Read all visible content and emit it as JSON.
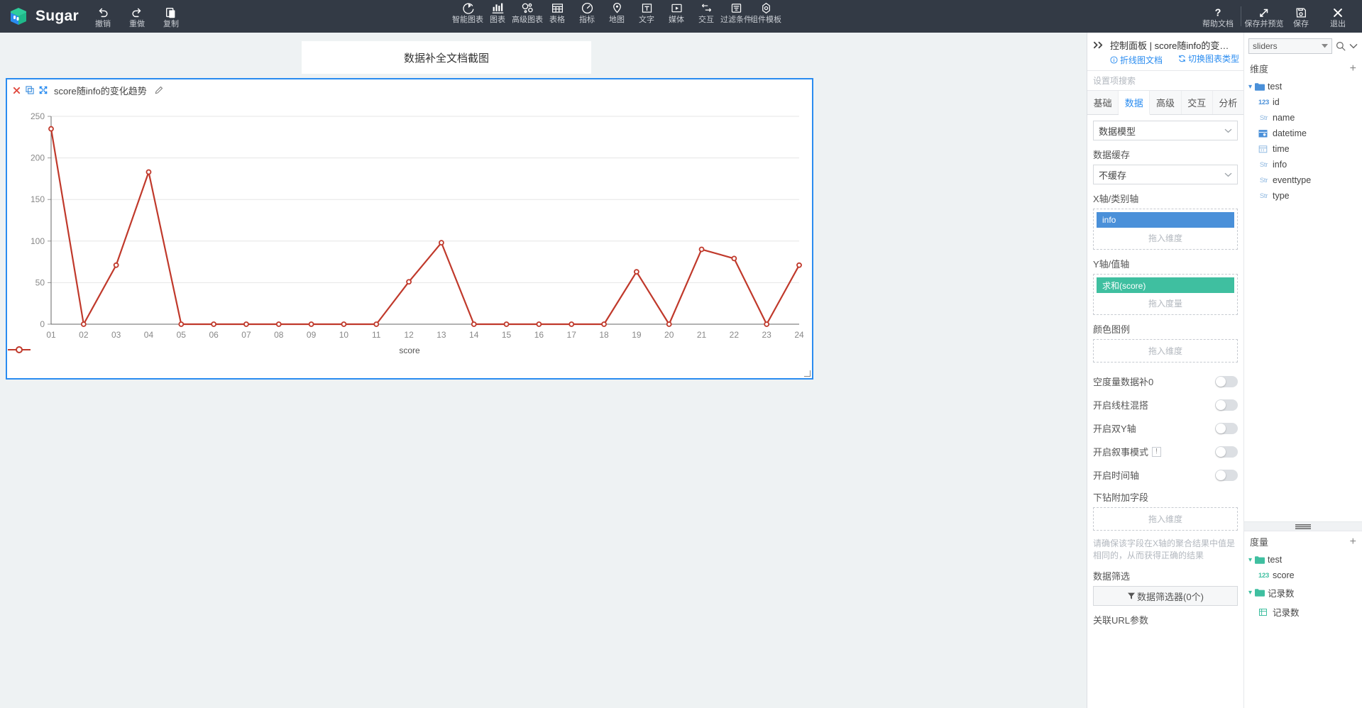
{
  "app": {
    "brand": "Sugar",
    "history": [
      {
        "icon": "undo-icon",
        "label": "撤销"
      },
      {
        "icon": "redo-icon",
        "label": "重做"
      },
      {
        "icon": "copy-icon",
        "label": "复制"
      }
    ],
    "insert_tools": [
      {
        "icon": "smart-chart-icon",
        "label": "智能图表"
      },
      {
        "icon": "chart-icon",
        "label": "图表"
      },
      {
        "icon": "advanced-chart-icon",
        "label": "高级图表"
      },
      {
        "icon": "table-icon",
        "label": "表格"
      },
      {
        "icon": "metric-icon",
        "label": "指标"
      },
      {
        "icon": "map-icon",
        "label": "地图"
      },
      {
        "icon": "text-icon",
        "label": "文字"
      },
      {
        "icon": "media-icon",
        "label": "媒体"
      },
      {
        "icon": "interaction-icon",
        "label": "交互"
      },
      {
        "icon": "filter-condition-icon",
        "label": "过滤条件"
      },
      {
        "icon": "component-template-icon",
        "label": "组件模板"
      }
    ],
    "right_tools": [
      {
        "icon": "help-icon",
        "label": "帮助文档"
      },
      {
        "icon": "save-preview-icon",
        "label": "保存并预览"
      },
      {
        "icon": "save-icon",
        "label": "保存"
      },
      {
        "icon": "exit-icon",
        "label": "退出"
      }
    ]
  },
  "canvas": {
    "doc_title": "数据补全文档截图",
    "chart_card": {
      "title": "score随info的变化趋势",
      "actions": [
        "close-icon",
        "duplicate-icon",
        "fullscreen-icon",
        "edit-pencil-icon"
      ]
    }
  },
  "chart_data": {
    "type": "line",
    "title": "score随info的变化趋势",
    "categories": [
      "01",
      "02",
      "03",
      "04",
      "05",
      "06",
      "07",
      "08",
      "09",
      "10",
      "11",
      "12",
      "13",
      "14",
      "15",
      "16",
      "17",
      "18",
      "19",
      "20",
      "21",
      "22",
      "23",
      "24"
    ],
    "series": [
      {
        "name": "score",
        "color": "#c0392b",
        "values": [
          235,
          0,
          71,
          183,
          0,
          0,
          0,
          0,
          0,
          0,
          0,
          51,
          98,
          0,
          0,
          0,
          0,
          0,
          63,
          0,
          90,
          79,
          0,
          71
        ]
      }
    ],
    "ylabel": "",
    "xlabel": "",
    "ylim": [
      0,
      250
    ],
    "yticks": [
      0,
      50,
      100,
      150,
      200,
      250
    ],
    "grid": true,
    "legend": [
      "score"
    ],
    "legend_position": "bottom"
  },
  "panel": {
    "title": "控制面板 | score随info的变化趋势",
    "doc_link": "折线图文档",
    "switch_type": "切换图表类型",
    "search_placeholder": "设置项搜索",
    "tabs": [
      {
        "label": "基础",
        "active": false
      },
      {
        "label": "数据",
        "active": true
      },
      {
        "label": "高级",
        "active": false
      },
      {
        "label": "交互",
        "active": false
      },
      {
        "label": "分析",
        "active": false
      }
    ],
    "settings": {
      "data_model_value": "数据模型",
      "cache_label": "数据缓存",
      "cache_value": "不缓存",
      "x_axis_label": "X轴/类别轴",
      "x_axis_pill": "info",
      "x_axis_drop_hint": "拖入维度",
      "y_axis_label": "Y轴/值轴",
      "y_axis_pill": "求和(score)",
      "y_axis_drop_hint": "拖入度量",
      "color_legend_label": "颜色图例",
      "color_legend_drop_hint": "拖入维度",
      "toggles": [
        {
          "label": "空度量数据补0",
          "on": false,
          "tip": false
        },
        {
          "label": "开启线柱混搭",
          "on": false,
          "tip": false
        },
        {
          "label": "开启双Y轴",
          "on": false,
          "tip": false
        },
        {
          "label": "开启叙事模式",
          "on": false,
          "tip": true,
          "tip_glyph": "!"
        },
        {
          "label": "开启时间轴",
          "on": false,
          "tip": false
        }
      ],
      "drill_label": "下钻附加字段",
      "drill_drop_hint": "拖入维度",
      "drill_hint": "请确保该字段在X轴的聚合结果中值是相同的，从而获得正确的结果",
      "filter_label": "数据筛选",
      "filter_button": "数据筛选器(0个)",
      "url_param_label": "关联URL参数"
    }
  },
  "fields": {
    "model_select": "sliders",
    "dimensions": {
      "header": "维度",
      "folders": [
        {
          "name": "test",
          "items": [
            {
              "type": "123",
              "name": "id"
            },
            {
              "type": "Str",
              "name": "name"
            },
            {
              "type": "datetime",
              "name": "datetime"
            },
            {
              "type": "date",
              "name": "time"
            },
            {
              "type": "Str",
              "name": "info"
            },
            {
              "type": "Str",
              "name": "eventtype"
            },
            {
              "type": "Str",
              "name": "type"
            }
          ]
        }
      ]
    },
    "measures": {
      "header": "度量",
      "folders": [
        {
          "name": "test",
          "items": [
            {
              "type": "123",
              "name": "score"
            }
          ]
        },
        {
          "name": "记录数",
          "items": [
            {
              "type": "count",
              "name": "记录数"
            }
          ]
        }
      ]
    }
  }
}
